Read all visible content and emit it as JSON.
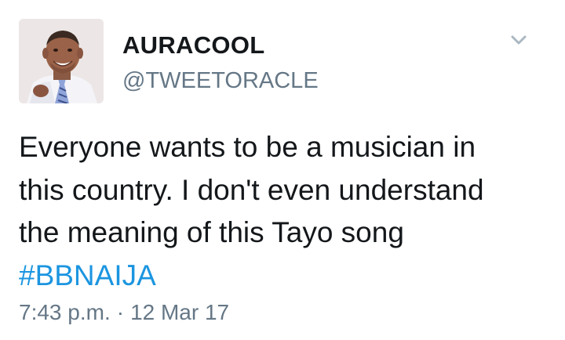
{
  "tweet": {
    "display_name": "AURACOOL",
    "handle": "@TWEETORACLE",
    "text_lines": [
      "Everyone wants to be a musician in",
      "this country. I don't even understand",
      "the meaning of this Tayo song"
    ],
    "hashtag": "#BBNAIJA",
    "time": "7:43 p.m.",
    "separator": "·",
    "date": "12 Mar 17",
    "menu_icon": "chevron-down-icon",
    "avatar_icon": "profile-photo"
  },
  "colors": {
    "text": "#14171a",
    "secondary": "#657786",
    "link": "#1b95e0",
    "chevron": "#aab8c2"
  }
}
